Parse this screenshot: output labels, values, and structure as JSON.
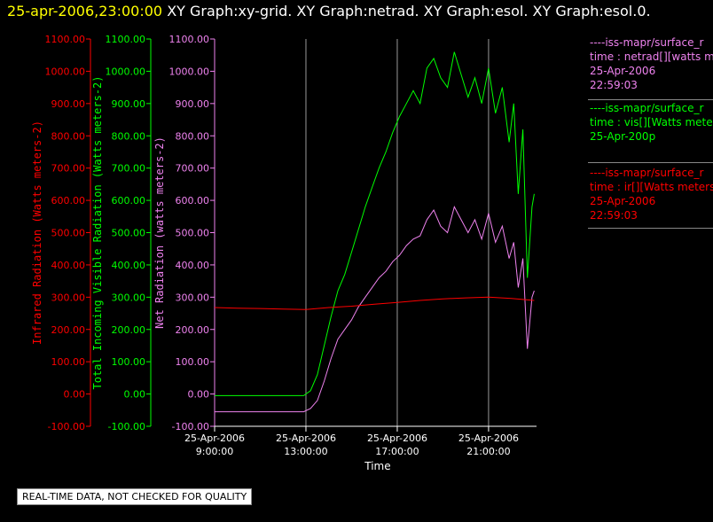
{
  "header": {
    "timestamp": "25-apr-2006,23:00:00",
    "graphs": "XY Graph:xy-grid.  XY Graph:netrad.  XY Graph:esol.  XY Graph:esol.0."
  },
  "footer_note": "REAL-TIME DATA, NOT CHECKED FOR QUALITY",
  "legend": {
    "netrad": [
      "----iss-mapr/surface_r",
      "time : netrad[][watts m",
      "25-Apr-2006",
      "22:59:03"
    ],
    "vis": [
      "----iss-mapr/surface_r",
      "time : vis[][Watts meter",
      "25-Apr-200p"
    ],
    "ir": [
      "----iss-mapr/surface_r",
      "time : ir[][Watts meters",
      "25-Apr-2006",
      "22:59:03"
    ]
  },
  "colors": {
    "background": "#000000",
    "ir": "#ff0000",
    "vis": "#00ff00",
    "netrad": "#ee82ee",
    "grid": "#999999",
    "axis": "#ffffff",
    "timestamp": "#ffff00"
  },
  "chart_data": {
    "type": "line",
    "xlabel": "Time",
    "x_ticks": [
      "25-Apr-2006\n9:00:00",
      "25-Apr-2006\n13:00:00",
      "25-Apr-2006\n17:00:00",
      "25-Apr-2006\n21:00:00"
    ],
    "x_tick_hours": [
      9,
      13,
      17,
      21
    ],
    "xlim_hours": [
      9,
      23.1
    ],
    "grid": "vertical at x ticks",
    "y_axes": [
      {
        "id": "ir",
        "label": "Infrared Radiation (Watts meters-2)",
        "color": "#ff0000",
        "ylim": [
          -100,
          1100
        ],
        "ticks": [
          "-100.00",
          "0.00",
          "100.00",
          "200.00",
          "300.00",
          "400.00",
          "500.00",
          "600.00",
          "700.00",
          "800.00",
          "900.00",
          "1000.00",
          "1100.00"
        ]
      },
      {
        "id": "vis",
        "label": "Total Incoming Visible Radiation (Watts meters-2)",
        "color": "#00ff00",
        "ylim": [
          -100,
          1100
        ],
        "ticks": [
          "-100.00",
          "0.00",
          "100.00",
          "200.00",
          "300.00",
          "400.00",
          "500.00",
          "600.00",
          "700.00",
          "800.00",
          "900.00",
          "1000.00",
          "1100.00"
        ]
      },
      {
        "id": "netrad",
        "label": "Net Radiation (watts meters-2)",
        "color": "#ee82ee",
        "ylim": [
          -100,
          1100
        ],
        "ticks": [
          "-100.00",
          "0.00",
          "100.00",
          "200.00",
          "300.00",
          "400.00",
          "500.00",
          "600.00",
          "700.00",
          "800.00",
          "900.00",
          "1000.00",
          "1100.00"
        ]
      }
    ],
    "series": [
      {
        "id": "vis",
        "color": "#00ff00",
        "x": [
          9.0,
          10.0,
          11.0,
          12.0,
          12.9,
          13.2,
          13.5,
          13.8,
          14.1,
          14.4,
          14.7,
          15.0,
          15.3,
          15.6,
          15.9,
          16.2,
          16.5,
          16.8,
          17.1,
          17.4,
          17.7,
          18.0,
          18.3,
          18.6,
          18.9,
          19.2,
          19.5,
          19.8,
          20.1,
          20.4,
          20.7,
          21.0,
          21.3,
          21.6,
          21.9,
          22.1,
          22.3,
          22.5,
          22.7,
          22.9,
          23.0
        ],
        "y": [
          -5,
          -5,
          -5,
          -5,
          -5,
          10,
          60,
          150,
          240,
          320,
          370,
          440,
          510,
          580,
          640,
          700,
          750,
          810,
          860,
          900,
          940,
          900,
          1010,
          1040,
          980,
          950,
          1060,
          990,
          920,
          980,
          900,
          1010,
          870,
          950,
          780,
          900,
          620,
          820,
          360,
          580,
          620
        ]
      },
      {
        "id": "netrad",
        "color": "#ee82ee",
        "x": [
          9.0,
          10.0,
          11.0,
          12.0,
          12.9,
          13.2,
          13.5,
          13.8,
          14.1,
          14.4,
          14.7,
          15.0,
          15.3,
          15.6,
          15.9,
          16.2,
          16.5,
          16.8,
          17.1,
          17.4,
          17.7,
          18.0,
          18.3,
          18.6,
          18.9,
          19.2,
          19.5,
          19.8,
          20.1,
          20.4,
          20.7,
          21.0,
          21.3,
          21.6,
          21.9,
          22.1,
          22.3,
          22.5,
          22.7,
          22.9,
          23.0
        ],
        "y": [
          -55,
          -55,
          -55,
          -55,
          -55,
          -45,
          -20,
          40,
          110,
          170,
          200,
          230,
          270,
          300,
          330,
          360,
          380,
          410,
          430,
          460,
          480,
          490,
          540,
          570,
          520,
          500,
          580,
          540,
          500,
          540,
          480,
          560,
          470,
          520,
          420,
          470,
          330,
          420,
          140,
          300,
          320
        ]
      },
      {
        "id": "ir",
        "color": "#ff0000",
        "x": [
          9.0,
          10.0,
          11.0,
          12.0,
          13.0,
          14.0,
          15.0,
          16.0,
          17.0,
          18.0,
          19.0,
          20.0,
          21.0,
          22.0,
          23.0
        ],
        "y": [
          268,
          266,
          265,
          263,
          262,
          268,
          272,
          278,
          284,
          290,
          295,
          298,
          300,
          296,
          290
        ]
      }
    ]
  }
}
